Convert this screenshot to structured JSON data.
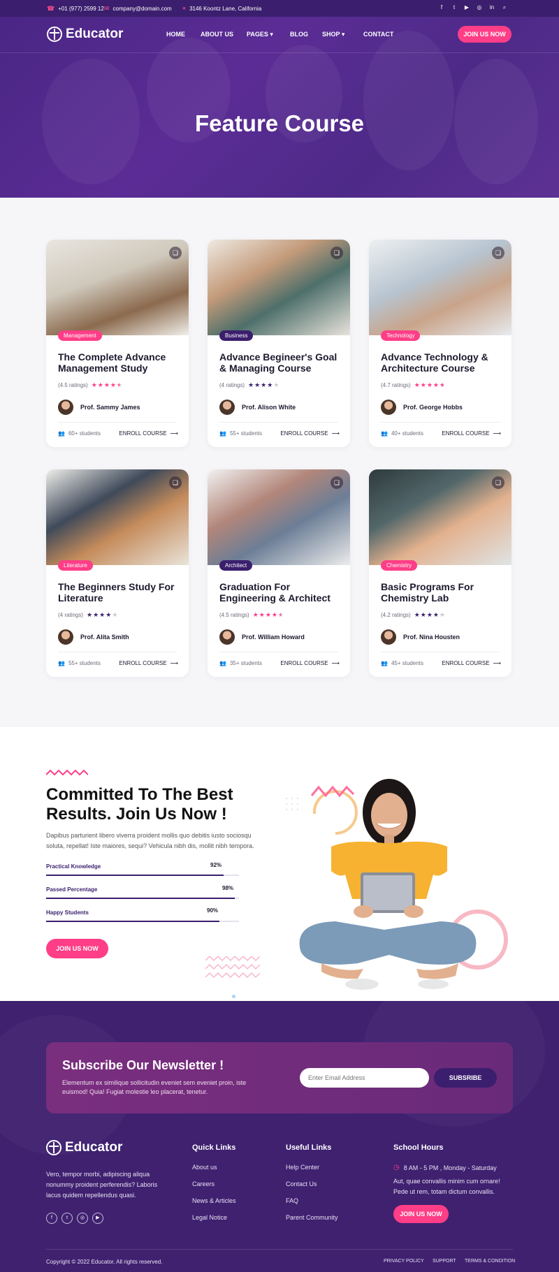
{
  "topbar": {
    "phone": "+01 (977) 2599 12",
    "email": "company@domain.com",
    "address": "3146 Koontz Lane, California",
    "social": [
      "facebook-icon",
      "twitter-icon",
      "youtube-icon",
      "instagram-icon",
      "linkedin-icon",
      "search-icon"
    ]
  },
  "nav": {
    "logo": "Educator",
    "items": [
      "HOME",
      "ABOUT US",
      "PAGES",
      "BLOG",
      "SHOP",
      "CONTACT"
    ],
    "cta": "JOIN US NOW"
  },
  "hero": {
    "title": "Feature Course"
  },
  "courses": [
    {
      "category": "Management",
      "cat_color": "#ff3e87",
      "title": "The Complete Advance Management Study",
      "ratings": "(4.5 ratings)",
      "rating_value": 4.5,
      "star_color": "#ff3e87",
      "instructor": "Prof. Sammy James",
      "students": "60+ students",
      "enroll": "ENROLL COURSE"
    },
    {
      "category": "Business",
      "cat_color": "#3b1f6e",
      "title": "Advance Begineer's Goal & Managing Course",
      "ratings": "(4 ratings)",
      "rating_value": 4,
      "star_color": "#3b1f6e",
      "instructor": "Prof. Alison White",
      "students": "55+ students",
      "enroll": "ENROLL COURSE"
    },
    {
      "category": "Technology",
      "cat_color": "#ff3e87",
      "title": "Advance Technology & Architecture Course",
      "ratings": "(4.7 ratings)",
      "rating_value": 4.7,
      "star_color": "#ff3e87",
      "instructor": "Prof. George Hobbs",
      "students": "40+ students",
      "enroll": "ENROLL COURSE"
    },
    {
      "category": "Literature",
      "cat_color": "#ff3e87",
      "title": "The Beginners Study For Literature",
      "ratings": "(4 ratings)",
      "rating_value": 4,
      "star_color": "#3b1f6e",
      "instructor": "Prof. Alita Smith",
      "students": "55+ students",
      "enroll": "ENROLL COURSE"
    },
    {
      "category": "Architect",
      "cat_color": "#3b1f6e",
      "title": "Graduation For Engineering & Architect",
      "ratings": "(4.5 ratings)",
      "rating_value": 4.5,
      "star_color": "#ff3e87",
      "instructor": "Prof. William Howard",
      "students": "35+ students",
      "enroll": "ENROLL COURSE"
    },
    {
      "category": "Chemistry",
      "cat_color": "#ff3e87",
      "title": "Basic Programs For Chemistry Lab",
      "ratings": "(4.2 ratings)",
      "rating_value": 4.2,
      "star_color": "#3b1f6e",
      "instructor": "Prof. Nina Housten",
      "students": "45+ students",
      "enroll": "ENROLL COURSE"
    }
  ],
  "commit": {
    "title_line1": "Committed To The Best",
    "title_line2": "Results. Join Us Now !",
    "text": "Dapibus parturient libero viverra proident mollis quo debitis iusto sociosqu soluta, repellat! Iste maiores, sequi? Vehicula nibh dis, mollit nibh tempora.",
    "bars": [
      {
        "label": "Practical Knowledge",
        "pct": "92%",
        "value": 0.92
      },
      {
        "label": "Passed Percentage",
        "pct": "98%",
        "value": 0.98
      },
      {
        "label": "Happy Students",
        "pct": "90%",
        "value": 0.9
      }
    ],
    "cta": "JOIN US NOW"
  },
  "newsletter": {
    "title": "Subscribe Our Newsletter !",
    "text": "Elementum ex similique sollicitudin eveniet sem eveniet proin, iste euismod! Quia! Fugiat molestie leo placerat, tenetur.",
    "placeholder": "Enter Email Address",
    "button": "SUBSRIBE"
  },
  "footer": {
    "logo": "Educator",
    "about": "Vero, tempor morbi, adipiscing aliqua nonummy proident perferendis? Laboris lacus quidem repellendus quasi.",
    "quick_title": "Quick Links",
    "quick": [
      "About us",
      "Careers",
      "News & Articles",
      "Legal Notice"
    ],
    "useful_title": "Useful Links",
    "useful": [
      "Help Center",
      "Contact Us",
      "FAQ",
      "Parent Community"
    ],
    "hours_title": "School Hours",
    "hours": "8 AM - 5 PM , Monday - Saturday",
    "hours_text": "Aut, quae convallis minim cum ornare! Pede ut rem, totam dictum convallis.",
    "cta": "JOIN US NOW",
    "copyright": "Copyright © 2022 Educator. All rights reserved.",
    "bottom_links": [
      "PRIVACY POLICY",
      "SUPPORT",
      "TERMS & CONDITION"
    ]
  }
}
